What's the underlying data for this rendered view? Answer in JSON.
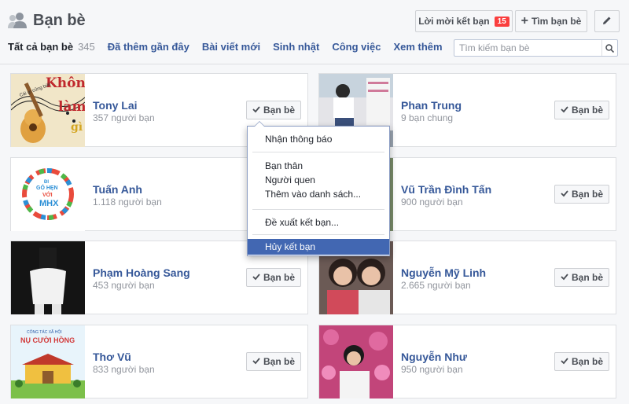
{
  "header": {
    "title": "Bạn bè",
    "friend_requests_label": "Lời mời kết bạn",
    "friend_requests_count": "15",
    "find_friends_label": "Tìm bạn bè"
  },
  "tabs": [
    {
      "label": "Tất cả bạn bè",
      "count": "345"
    },
    {
      "label": "Đã thêm gần đây"
    },
    {
      "label": "Bài viết mới"
    },
    {
      "label": "Sinh nhật"
    },
    {
      "label": "Công việc"
    },
    {
      "label": "Xem thêm"
    }
  ],
  "search": {
    "placeholder": "Tìm kiếm bạn bè",
    "value": ""
  },
  "friends": [
    {
      "name": "Tony Lai",
      "sub": "357 người bạn",
      "button": "Bạn bè"
    },
    {
      "name": "Phan Trung",
      "sub": "9 bạn chung",
      "button": "Bạn bè"
    },
    {
      "name": "Tuấn Anh",
      "sub": "1.118 người bạn",
      "button": "Bạn bè"
    },
    {
      "name": "Vũ Trần Đình Tấn",
      "sub": "900 người bạn",
      "button": "Bạn bè"
    },
    {
      "name": "Phạm Hoàng Sang",
      "sub": "453 người bạn",
      "button": "Bạn bè"
    },
    {
      "name": "Nguyễn Mỹ Linh",
      "sub": "2.665 người bạn",
      "button": "Bạn bè"
    },
    {
      "name": "Thơ Vũ",
      "sub": "833 người bạn",
      "button": "Bạn bè"
    },
    {
      "name": "Nguyễn Như",
      "sub": "950 người bạn",
      "button": "Bạn bè"
    }
  ],
  "thumb_text": {
    "tony_lai": [
      "Không",
      "làm",
      "gì"
    ],
    "tony_lai_small": "Cái gì cũng biết",
    "tuan_anh": [
      "ĐI",
      "GÓ HẸN",
      "VỚI",
      "MHX"
    ],
    "tho_vu": [
      "CÔNG TÁC XÃ HỘI",
      "NỤ CƯỜI HỒNG"
    ]
  },
  "dropdown": {
    "items": [
      {
        "label": "Nhận thông báo"
      },
      {
        "label": "Bạn thân"
      },
      {
        "label": "Người quen"
      },
      {
        "label": "Thêm vào danh sách..."
      },
      {
        "label": "Đề xuất kết bạn..."
      },
      {
        "label": "Hủy kết bạn",
        "selected": true
      }
    ]
  },
  "colors": {
    "link": "#365899",
    "badge": "#fa3e3e",
    "menu_selected": "#4267b2"
  }
}
